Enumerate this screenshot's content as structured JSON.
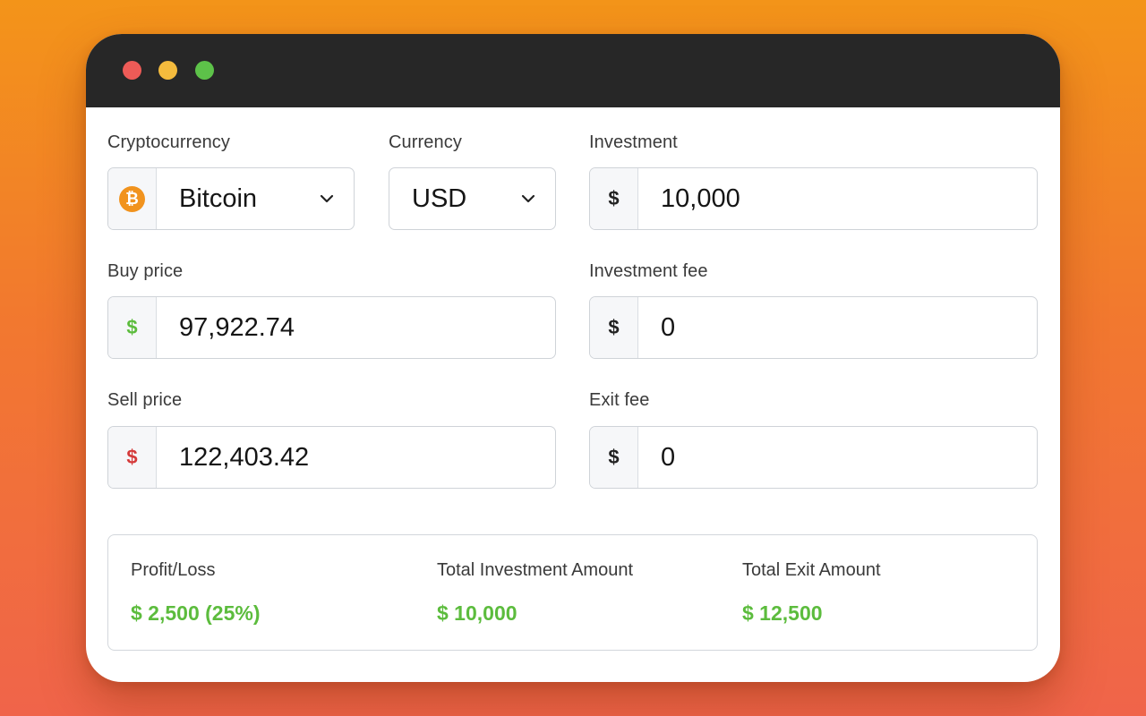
{
  "window": {
    "controls": [
      "close",
      "minimize",
      "maximize"
    ]
  },
  "form": {
    "cryptocurrency": {
      "label": "Cryptocurrency",
      "value": "Bitcoin",
      "icon": "bitcoin-icon",
      "icon_glyph": "₿"
    },
    "currency": {
      "label": "Currency",
      "value": "USD"
    },
    "investment": {
      "label": "Investment",
      "prefix": "$",
      "value": "10,000"
    },
    "buy_price": {
      "label": "Buy price",
      "prefix": "$",
      "value": "97,922.74"
    },
    "investment_fee": {
      "label": "Investment fee",
      "prefix": "$",
      "value": "0"
    },
    "sell_price": {
      "label": "Sell price",
      "prefix": "$",
      "value": "122,403.42"
    },
    "exit_fee": {
      "label": "Exit fee",
      "prefix": "$",
      "value": "0"
    }
  },
  "summary": {
    "profit_loss": {
      "label": "Profit/Loss",
      "value": "$ 2,500 (25%)"
    },
    "total_investment": {
      "label": "Total Investment Amount",
      "value": "$ 10,000"
    },
    "total_exit": {
      "label": "Total Exit Amount",
      "value": "$ 12,500"
    }
  },
  "colors": {
    "profit": "#5cbc3d",
    "loss": "#d53a3a",
    "bitcoin": "#f1931e",
    "titlebar": "#272727"
  }
}
